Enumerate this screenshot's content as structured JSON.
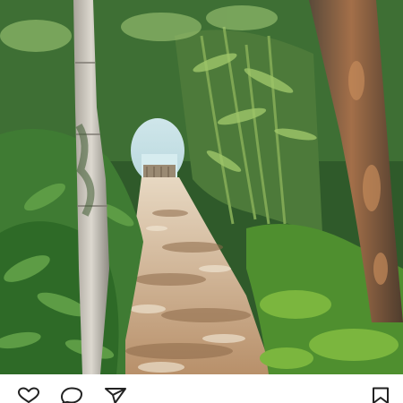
{
  "post": {
    "photo": {
      "subject": "forest-path-photo"
    }
  },
  "action_bar": {
    "icons": [
      "heart-icon",
      "comment-icon",
      "share-icon",
      "bookmark-icon"
    ]
  }
}
